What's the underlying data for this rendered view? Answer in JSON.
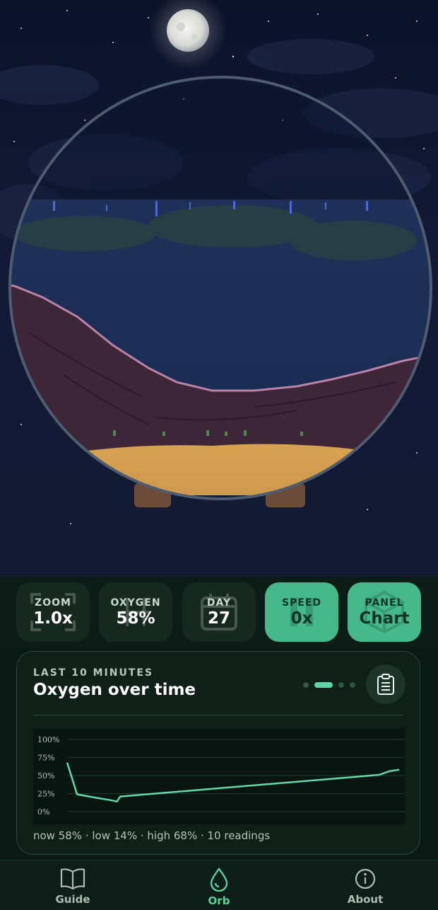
{
  "stats": [
    {
      "label": "ZOOM",
      "value": "1.0x",
      "icon": "zoom-icon",
      "active": false
    },
    {
      "label": "OXYGEN",
      "value": "58%",
      "icon": "oxygen-icon",
      "active": false
    },
    {
      "label": "DAY",
      "value": "27",
      "icon": "calendar-icon",
      "active": false
    },
    {
      "label": "SPEED",
      "value": "0x",
      "icon": "pause-icon",
      "active": true
    },
    {
      "label": "PANEL",
      "value": "Chart",
      "icon": "cube-icon",
      "active": true
    }
  ],
  "card": {
    "kicker": "LAST 10 MINUTES",
    "title": "Oxygen over time",
    "page_count": 4,
    "active_page": 1,
    "summary": "now 58% · low 14% · high 68% · 10 readings"
  },
  "chart_data": {
    "type": "line",
    "y_ticks": [
      "100%",
      "75%",
      "50%",
      "25%",
      "0%"
    ],
    "ylim": [
      0,
      100
    ],
    "series": [
      {
        "values": [
          68,
          24,
          19,
          16,
          14,
          21,
          51,
          56,
          58
        ],
        "t": [
          0,
          0.03,
          0.09,
          0.13,
          0.15,
          0.16,
          0.94,
          0.97,
          1.0
        ]
      }
    ],
    "grid": true,
    "line_color": "#63d8a9"
  },
  "tabs": [
    {
      "label": "Guide",
      "icon": "book-icon",
      "active": false
    },
    {
      "label": "Orb",
      "icon": "water-drop-icon",
      "active": true
    },
    {
      "label": "About",
      "icon": "info-icon",
      "active": false
    }
  ],
  "colors": {
    "accent": "#46b98c",
    "background": "#0a1a14"
  }
}
